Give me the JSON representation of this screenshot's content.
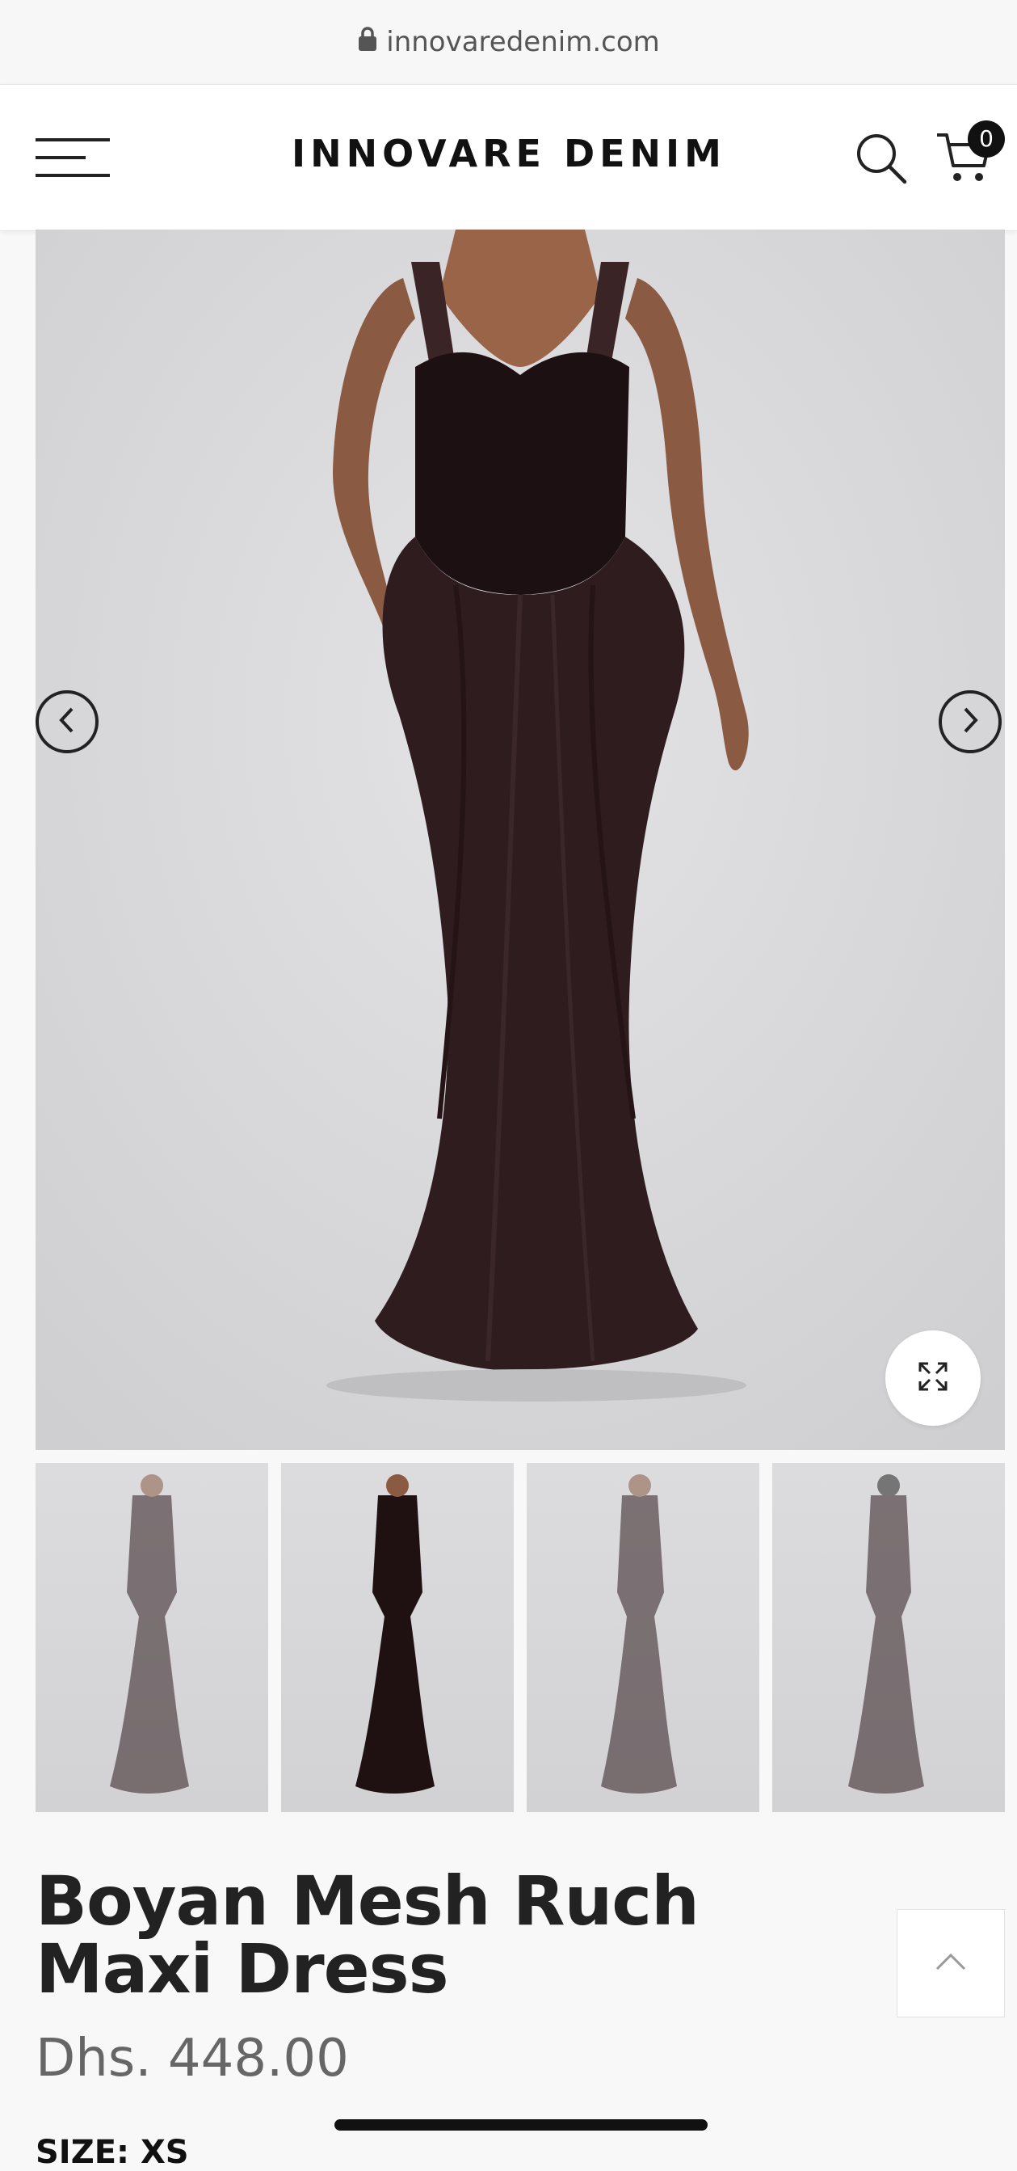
{
  "browser": {
    "url": "innovaredenim.com"
  },
  "header": {
    "logo": "INNOVARE DENIM",
    "cart_count": "0"
  },
  "icons": {
    "lock": "lock-icon",
    "menu": "hamburger-menu-icon",
    "search": "search-icon",
    "cart": "cart-icon",
    "prev": "chevron-left-icon",
    "next": "chevron-right-icon",
    "zoom": "expand-icon",
    "back_to_top": "chevron-up-icon"
  },
  "gallery": {
    "thumbnail_count": 4,
    "active_thumbnail": 2
  },
  "product": {
    "title": "Boyan Mesh Ruch Maxi Dress",
    "price": "Dhs. 448.00",
    "size_label": "SIZE: XS"
  },
  "colors": {
    "dress": "#2e1c1f",
    "background": "#d8d8da",
    "accent": "#111111"
  }
}
